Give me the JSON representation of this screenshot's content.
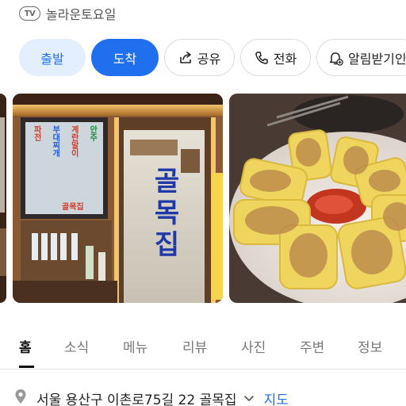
{
  "header": {
    "tv_badge": "TV",
    "tv_program": "놀라운토요일"
  },
  "actions": {
    "depart": "출발",
    "arrive": "도착",
    "share": "공유",
    "call": "전화",
    "alarm": "알림받기인"
  },
  "photos": {
    "sign_text": "골목집",
    "menu_board": [
      "안주",
      "계란말이",
      "부대찌개",
      "파전"
    ],
    "menu_board_sub": "골목집"
  },
  "tabs": [
    "홈",
    "소식",
    "메뉴",
    "리뷰",
    "사진",
    "주변",
    "정보"
  ],
  "address": {
    "text": "서울 용산구 이촌로75길 22 골목집",
    "map_link": "지도"
  },
  "colors": {
    "accent": "#1f6fee",
    "accent_light": "#e4effd"
  }
}
